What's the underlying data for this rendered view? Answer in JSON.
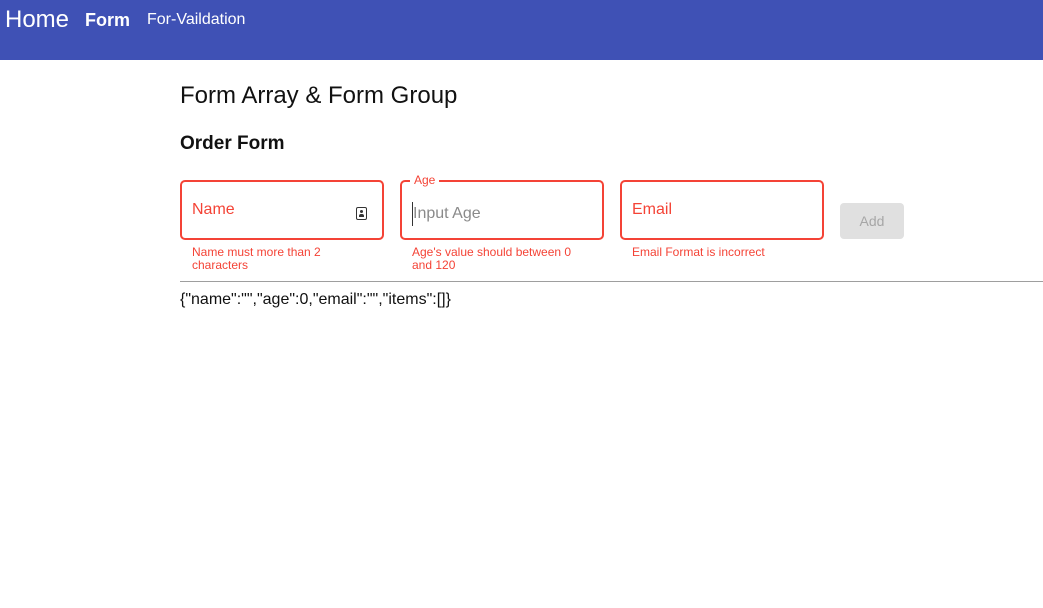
{
  "nav": {
    "home": "Home",
    "form": "Form",
    "validation": "For-Vaildation"
  },
  "page": {
    "title": "Form Array & Form Group",
    "form_title": "Order Form"
  },
  "fields": {
    "name": {
      "label": "Name",
      "value": "",
      "error": "Name must more than 2 characters"
    },
    "age": {
      "label": "Age",
      "placeholder": "Input Age",
      "value": "",
      "error": "Age's value should between 0 and 120"
    },
    "email": {
      "label": "Email",
      "value": "",
      "error": "Email Format is incorrect"
    }
  },
  "actions": {
    "add_label": "Add"
  },
  "output": {
    "json": "{\"name\":\"\",\"age\":0,\"email\":\"\",\"items\":[]}"
  },
  "colors": {
    "toolbar": "#3f51b5",
    "error": "#f44336",
    "disabled_button": "#e0e0e0"
  }
}
